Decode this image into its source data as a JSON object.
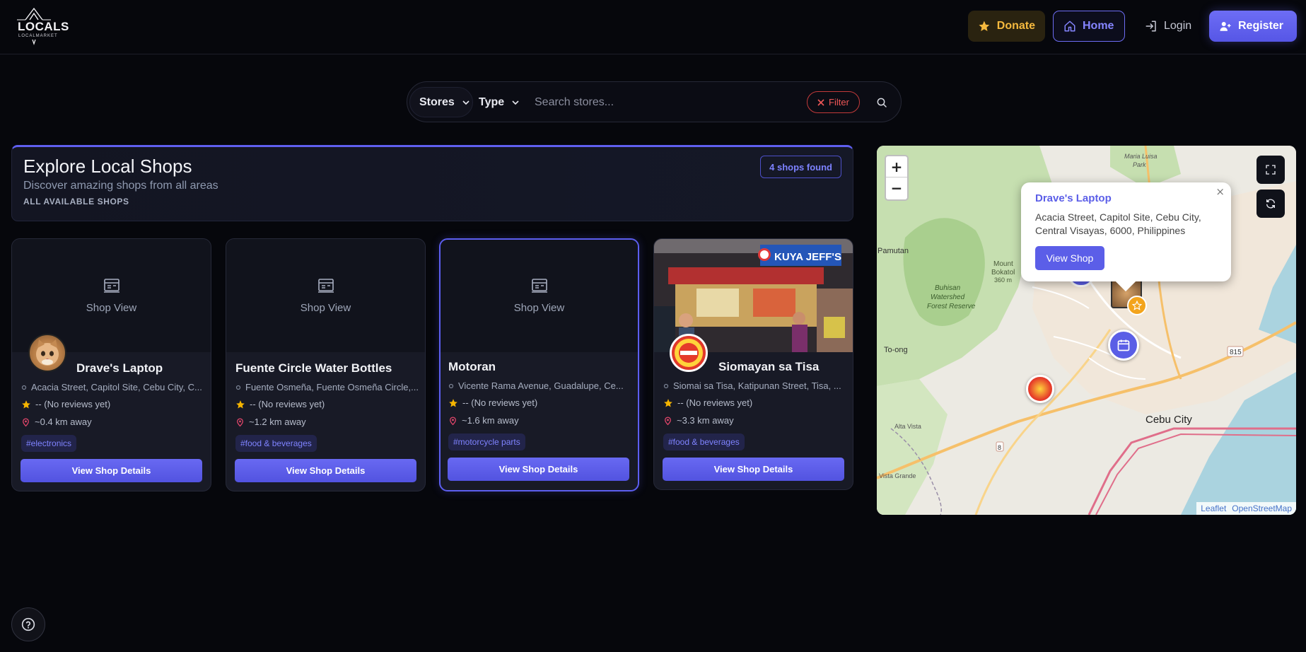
{
  "header": {
    "logo_text": "LOCALS",
    "logo_sub": "LOCALMARKET",
    "donate_label": "Donate",
    "home_label": "Home",
    "login_label": "Login",
    "register_label": "Register"
  },
  "search": {
    "stores_label": "Stores",
    "type_label": "Type",
    "placeholder": "Search stores...",
    "filter_label": "Filter"
  },
  "explore": {
    "title": "Explore Local Shops",
    "subtitle": "Discover amazing shops from all areas",
    "caption": "ALL AVAILABLE SHOPS",
    "count_badge": "4 shops found"
  },
  "shops": [
    {
      "image_label": "Shop View",
      "name": "Drave's Laptop",
      "address": "Acacia Street, Capitol Site, Cebu City, C...",
      "rating": "-- (No reviews yet)",
      "distance": "~0.4 km away",
      "tag": "#electronics",
      "button": "View Shop Details"
    },
    {
      "image_label": "Shop View",
      "name": "Fuente Circle Water Bottles",
      "address": "Fuente Osmeña, Fuente Osmeña Circle,...",
      "rating": "-- (No reviews yet)",
      "distance": "~1.2 km away",
      "tag": "#food & beverages",
      "button": "View Shop Details"
    },
    {
      "image_label": "Shop View",
      "name": "Motoran",
      "address": "Vicente Rama Avenue, Guadalupe, Ce...",
      "rating": "-- (No reviews yet)",
      "distance": "~1.6 km away",
      "tag": "#motorcycle parts",
      "button": "View Shop Details"
    },
    {
      "image_label": "",
      "name": "Siomayan sa Tisa",
      "address": "Siomai sa Tisa, Katipunan Street, Tisa, ...",
      "rating": "-- (No reviews yet)",
      "distance": "~3.3 km away",
      "tag": "#food & beverages",
      "button": "View Shop Details",
      "photo_sign": "KUYA JEFF'S"
    }
  ],
  "map": {
    "zoom_in": "+",
    "zoom_out": "−",
    "labels": {
      "pamutan": "Pamutan",
      "mount": "Mount",
      "bokatol": "Bokatol",
      "elev": "360 m",
      "buhisan1": "Buhisan",
      "buhisan2": "Watershed",
      "buhisan3": "Forest Reserve",
      "toong": "To-ong",
      "cebu": "Cebu City",
      "altavista": "Alta Vista",
      "vistagrande": "Vista Grande",
      "maria": "Maria Luisa",
      "park": "Park",
      "road815": "815",
      "road8": "8"
    },
    "popup": {
      "title": "Drave's Laptop",
      "address": "Acacia Street, Capitol Site, Cebu City, Central Visayas, 6000, Philippines",
      "button": "View Shop",
      "close": "×"
    },
    "attribution": {
      "leaflet": "Leaflet",
      "osm": "OpenStreetMap"
    }
  },
  "colors": {
    "accent": "#5f5ff0",
    "donate": "#f5b93e",
    "filter": "#ef5757",
    "star": "#f5b400",
    "pin": "#e0456a"
  }
}
